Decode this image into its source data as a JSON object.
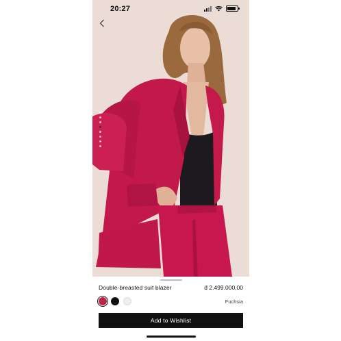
{
  "status_bar": {
    "time": "20:27",
    "battery_level": 0.85
  },
  "navigation": {
    "back_icon": "chevron-left-icon"
  },
  "gallery": {
    "image_count": 8,
    "active_index": 3
  },
  "product": {
    "name": "Double-breasted suit blazer",
    "price": "đ 2.499.000,00",
    "selected_color": "Fuchsia",
    "colors": [
      {
        "name": "fuchsia",
        "hex": "#b8264a",
        "selected": true
      },
      {
        "name": "black",
        "hex": "#111111",
        "selected": false
      },
      {
        "name": "white",
        "hex": "#eeeeee",
        "selected": false
      }
    ]
  },
  "actions": {
    "wishlist_label": "Add to Wishlist"
  }
}
